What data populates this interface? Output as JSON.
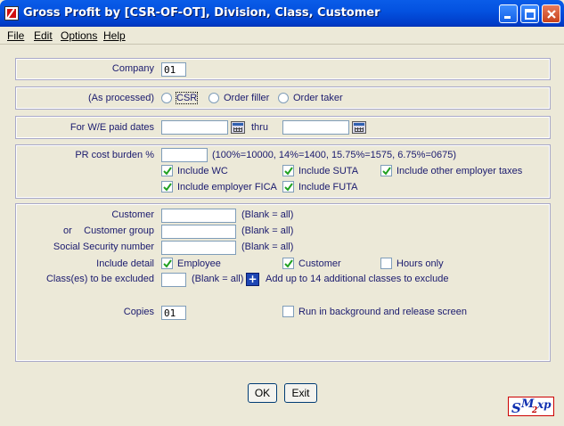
{
  "window": {
    "title": "Gross Profit by [CSR-OF-OT], Division, Class, Customer"
  },
  "menu": {
    "file": "File",
    "edit": "Edit",
    "options": "Options",
    "help": "Help"
  },
  "company": {
    "label": "Company",
    "value": "01"
  },
  "processed": {
    "label": "(As processed)",
    "options": [
      "CSR",
      "Order filler",
      "Order taker"
    ]
  },
  "dates": {
    "label": "For W/E paid dates",
    "thru": "thru",
    "from_value": "",
    "to_value": ""
  },
  "burden": {
    "label": "PR cost burden %",
    "value": "",
    "hint": "(100%=10000, 14%=1400, 15.75%=1575, 6.75%=0675)",
    "include_wc": "Include WC",
    "include_suta": "Include SUTA",
    "include_other": "Include other employer taxes",
    "include_fica": "Include employer FICA",
    "include_futa": "Include FUTA"
  },
  "filters": {
    "customer_label": "Customer",
    "or_label": "or",
    "group_label": "Customer group",
    "ssn_label": "Social Security number",
    "blank_all": "(Blank = all)",
    "detail_label": "Include detail",
    "employee": "Employee",
    "customer": "Customer",
    "hours_only": "Hours only",
    "classes_label": "Class(es) to be excluded",
    "classes_blank": "(Blank = all)",
    "add_classes": "Add up to 14 additional classes to exclude",
    "plus_symbol": "+"
  },
  "copies": {
    "label": "Copies",
    "value": "01",
    "background": "Run in background and release screen"
  },
  "buttons": {
    "ok": "OK",
    "exit": "Exit"
  },
  "logo": {
    "text": "SMxp"
  }
}
